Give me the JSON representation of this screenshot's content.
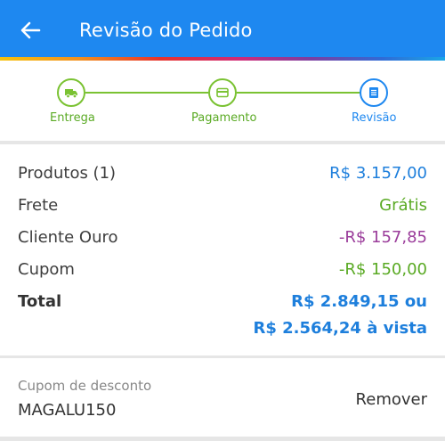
{
  "header": {
    "title": "Revisão do Pedido",
    "back_icon": "arrow-left-icon",
    "background": "#1e88f0"
  },
  "stepper": {
    "steps": [
      {
        "label": "Entrega",
        "icon": "truck-icon",
        "state": "done"
      },
      {
        "label": "Pagamento",
        "icon": "card-icon",
        "state": "done"
      },
      {
        "label": "Revisão",
        "icon": "document-icon",
        "state": "current"
      }
    ],
    "colors": {
      "done": "#7ac232",
      "current": "#1e88f0"
    }
  },
  "summary": {
    "products_label": "Produtos (1)",
    "products_value": "R$ 3.157,00",
    "shipping_label": "Frete",
    "shipping_value": "Grátis",
    "gold_label": "Cliente Ouro",
    "gold_value": "-R$ 157,85",
    "coupon_label": "Cupom",
    "coupon_value": "-R$ 150,00",
    "total_label": "Total",
    "total_value": "R$ 2.849,15 ou",
    "total_cash": "R$ 2.564,24 à vista"
  },
  "coupon": {
    "caption": "Cupom de desconto",
    "code": "MAGALU150",
    "remove_label": "Remover"
  }
}
